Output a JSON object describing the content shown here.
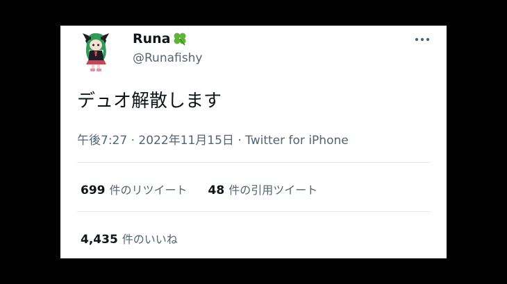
{
  "tweet": {
    "display_name": "Runa",
    "handle": "@Runafishy",
    "text": "デュオ解散します",
    "time": "午後7:27",
    "separator": "·",
    "date": "2022年11月15日",
    "source": "Twitter for iPhone"
  },
  "stats": {
    "retweets_count": "699",
    "retweets_label": "件のリツイート",
    "quotes_count": "48",
    "quotes_label": "件の引用ツイート",
    "likes_count": "4,435",
    "likes_label": "件のいいね"
  },
  "icons": {
    "name_emoji": "four-leaf-clover-icon",
    "more": "more-options-icon"
  },
  "colors": {
    "text_primary": "#0f1419",
    "text_secondary": "#536471",
    "clover_green": "#5fb336",
    "background": "#000000",
    "card": "#ffffff"
  }
}
